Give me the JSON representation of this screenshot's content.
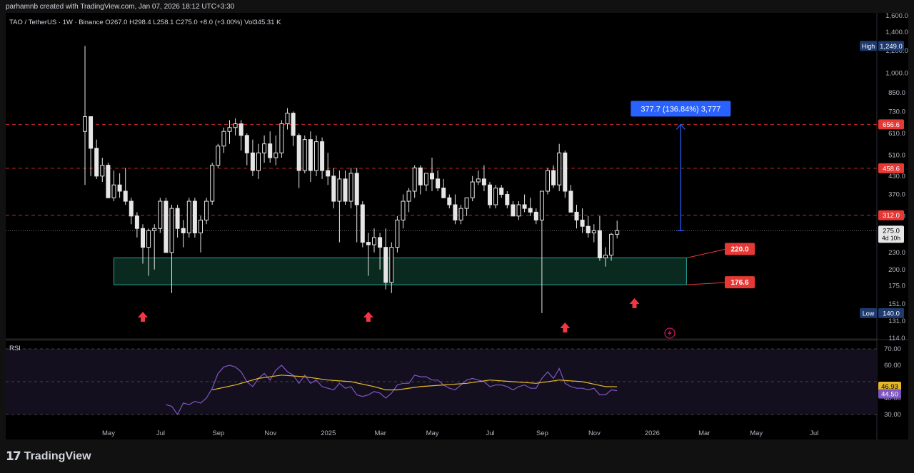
{
  "header": {
    "caption": "parhamnb created with TradingView.com, Jan 07, 2026 18:12 UTC+3:30",
    "symbol_line": "TAO / TetherUS · 1W · Binance  O267.0  H298.4  L258.1  C275.0  +8.0 (+3.00%)  Vol345.31 K"
  },
  "footer": {
    "brand": "TradingView",
    "logo_icon": "tradingview-logo-icon"
  },
  "colors": {
    "bg": "#000000",
    "frame": "#111111",
    "candle": "#e6e6e6",
    "level_line": "#c62828",
    "level_badge": "#e53935",
    "zone_border": "#26a69a",
    "zone_fill": "#0b2a1f",
    "measure": "#2962ff",
    "arrow": "#f23645",
    "rsi_line": "#7e57c2",
    "rsi_ma": "#e5b829",
    "rsi_band": "#130f1f",
    "high_low_badge": "#1e3a6e"
  },
  "chart_data": [
    {
      "type": "candlestick",
      "title": "TAO / TetherUS · 1W · Binance",
      "ohlc_last": {
        "open": 267.0,
        "high": 298.4,
        "low": 258.1,
        "close": 275.0,
        "change": 8.0,
        "change_pct": 3.0,
        "volume": "345.31 K"
      },
      "y_scale": "log",
      "ylim": [
        114,
        1600
      ],
      "y_ticks": [
        "1,600.0",
        "1,400.0",
        "1,200.0",
        "1,000.0",
        "850.0",
        "730.0",
        "610.0",
        "510.0",
        "430.0",
        "370.0",
        "310.0",
        "275.0",
        "230.0",
        "200.0",
        "175.0",
        "151.0",
        "131.0",
        "114.0"
      ],
      "y_tick_values": [
        1600,
        1400,
        1200,
        1000,
        850,
        730,
        610,
        510,
        430,
        370,
        310,
        275,
        230,
        200,
        175,
        151,
        131,
        114
      ],
      "x_labels": [
        "May",
        "Jul",
        "Sep",
        "Nov",
        "2025",
        "Mar",
        "May",
        "Jul",
        "Sep",
        "Nov",
        "2026",
        "Mar",
        "May",
        "Jul"
      ],
      "x_label_weeks": [
        0,
        9,
        19,
        28,
        38,
        47,
        56,
        66,
        75,
        84,
        94,
        103,
        112,
        122
      ],
      "first_week": "2024-04-29",
      "candles": [
        [
          0,
          620,
          1249,
          400,
          700
        ],
        [
          1,
          700,
          700,
          430,
          540
        ],
        [
          2,
          540,
          580,
          420,
          430
        ],
        [
          3,
          430,
          500,
          410,
          470
        ],
        [
          4,
          470,
          480,
          360,
          360
        ],
        [
          5,
          360,
          450,
          350,
          400
        ],
        [
          6,
          400,
          440,
          360,
          380
        ],
        [
          7,
          380,
          460,
          340,
          350
        ],
        [
          8,
          350,
          360,
          290,
          310
        ],
        [
          9,
          310,
          320,
          260,
          280
        ],
        [
          10,
          280,
          290,
          210,
          240
        ],
        [
          11,
          240,
          280,
          190,
          275
        ],
        [
          12,
          275,
          290,
          200,
          280
        ],
        [
          13,
          280,
          360,
          270,
          350
        ],
        [
          14,
          350,
          360,
          230,
          230
        ],
        [
          15,
          230,
          340,
          165,
          330
        ],
        [
          16,
          330,
          340,
          260,
          280
        ],
        [
          17,
          280,
          300,
          240,
          270
        ],
        [
          18,
          270,
          360,
          260,
          350
        ],
        [
          19,
          350,
          360,
          260,
          270
        ],
        [
          20,
          270,
          310,
          230,
          300
        ],
        [
          21,
          300,
          360,
          290,
          350
        ],
        [
          22,
          350,
          480,
          340,
          470
        ],
        [
          23,
          470,
          560,
          460,
          550
        ],
        [
          24,
          550,
          640,
          520,
          620
        ],
        [
          25,
          620,
          680,
          560,
          640
        ],
        [
          26,
          640,
          690,
          600,
          660
        ],
        [
          27,
          660,
          680,
          530,
          600
        ],
        [
          28,
          600,
          610,
          470,
          520
        ],
        [
          29,
          520,
          580,
          430,
          450
        ],
        [
          30,
          450,
          560,
          420,
          520
        ],
        [
          31,
          520,
          600,
          480,
          560
        ],
        [
          32,
          560,
          620,
          480,
          500
        ],
        [
          33,
          500,
          600,
          470,
          520
        ],
        [
          34,
          520,
          680,
          500,
          660
        ],
        [
          35,
          660,
          750,
          630,
          720
        ],
        [
          36,
          720,
          730,
          550,
          600
        ],
        [
          37,
          600,
          610,
          390,
          450
        ],
        [
          38,
          450,
          600,
          440,
          580
        ],
        [
          39,
          580,
          620,
          410,
          450
        ],
        [
          40,
          450,
          600,
          430,
          570
        ],
        [
          41,
          570,
          590,
          420,
          450
        ],
        [
          42,
          450,
          520,
          400,
          430
        ],
        [
          43,
          430,
          460,
          330,
          350
        ],
        [
          44,
          350,
          450,
          250,
          420
        ],
        [
          45,
          420,
          450,
          340,
          350
        ],
        [
          46,
          350,
          460,
          330,
          440
        ],
        [
          47,
          440,
          460,
          250,
          340
        ],
        [
          48,
          340,
          350,
          240,
          250
        ],
        [
          49,
          250,
          270,
          190,
          245
        ],
        [
          50,
          245,
          280,
          230,
          260
        ],
        [
          51,
          260,
          270,
          200,
          240
        ],
        [
          52,
          240,
          280,
          170,
          180
        ],
        [
          53,
          180,
          250,
          165,
          240
        ],
        [
          54,
          240,
          310,
          230,
          300
        ],
        [
          55,
          300,
          370,
          280,
          350
        ],
        [
          56,
          350,
          390,
          320,
          380
        ],
        [
          57,
          380,
          470,
          360,
          460
        ],
        [
          58,
          460,
          470,
          370,
          400
        ],
        [
          59,
          400,
          440,
          380,
          440
        ],
        [
          60,
          440,
          500,
          380,
          420
        ],
        [
          61,
          420,
          450,
          380,
          390
        ],
        [
          62,
          390,
          420,
          360,
          360
        ],
        [
          63,
          360,
          370,
          330,
          340
        ],
        [
          64,
          340,
          370,
          290,
          300
        ],
        [
          65,
          300,
          340,
          290,
          330
        ],
        [
          66,
          330,
          360,
          310,
          360
        ],
        [
          67,
          360,
          430,
          350,
          410
        ],
        [
          68,
          410,
          450,
          400,
          420
        ],
        [
          69,
          420,
          470,
          380,
          400
        ],
        [
          70,
          400,
          410,
          330,
          340
        ],
        [
          71,
          340,
          400,
          330,
          390
        ],
        [
          72,
          390,
          400,
          360,
          370
        ],
        [
          73,
          370,
          380,
          330,
          340
        ],
        [
          74,
          340,
          350,
          310,
          310
        ],
        [
          75,
          310,
          350,
          300,
          340
        ],
        [
          76,
          340,
          370,
          320,
          330
        ],
        [
          77,
          330,
          360,
          310,
          320
        ],
        [
          78,
          320,
          330,
          290,
          300
        ],
        [
          79,
          300,
          380,
          140,
          380
        ],
        [
          80,
          380,
          460,
          370,
          450
        ],
        [
          81,
          450,
          470,
          390,
          400
        ],
        [
          82,
          400,
          560,
          380,
          520
        ],
        [
          83,
          520,
          530,
          360,
          380
        ],
        [
          84,
          380,
          400,
          320,
          320
        ],
        [
          85,
          320,
          340,
          280,
          300
        ],
        [
          86,
          300,
          330,
          270,
          285
        ],
        [
          87,
          285,
          310,
          260,
          270
        ],
        [
          88,
          270,
          290,
          250,
          275
        ],
        [
          89,
          275,
          310,
          215,
          220
        ],
        [
          90,
          220,
          240,
          205,
          225
        ],
        [
          91,
          225,
          270,
          215,
          267
        ],
        [
          92,
          267,
          298.4,
          258.1,
          275
        ]
      ]
    },
    {
      "type": "line",
      "title": "RSI",
      "ylim": [
        22,
        76
      ],
      "y_ticks": [
        "70.00",
        "60.00",
        "40.00",
        "30.00"
      ],
      "y_tick_values": [
        70,
        60,
        40,
        30
      ],
      "band": [
        30,
        70
      ],
      "midline": 50,
      "series": [
        {
          "name": "RSI",
          "values": [
            [
              14,
              36
            ],
            [
              15,
              35
            ],
            [
              16,
              30
            ],
            [
              17,
              37
            ],
            [
              18,
              36
            ],
            [
              19,
              38
            ],
            [
              20,
              37
            ],
            [
              21,
              40
            ],
            [
              22,
              46
            ],
            [
              23,
              55
            ],
            [
              24,
              59
            ],
            [
              25,
              60
            ],
            [
              26,
              59
            ],
            [
              27,
              56
            ],
            [
              28,
              50
            ],
            [
              29,
              47
            ],
            [
              30,
              52
            ],
            [
              31,
              55
            ],
            [
              32,
              51
            ],
            [
              33,
              57
            ],
            [
              34,
              60
            ],
            [
              35,
              56
            ],
            [
              36,
              54
            ],
            [
              37,
              49
            ],
            [
              38,
              54
            ],
            [
              39,
              49
            ],
            [
              40,
              51
            ],
            [
              41,
              47
            ],
            [
              42,
              46
            ],
            [
              43,
              45
            ],
            [
              44,
              49
            ],
            [
              45,
              46
            ],
            [
              46,
              47
            ],
            [
              47,
              42
            ],
            [
              48,
              41
            ],
            [
              49,
              42
            ],
            [
              50,
              44
            ],
            [
              51,
              43
            ],
            [
              52,
              40
            ],
            [
              53,
              43
            ],
            [
              54,
              48
            ],
            [
              55,
              49
            ],
            [
              56,
              49
            ],
            [
              57,
              54
            ],
            [
              58,
              53
            ],
            [
              59,
              53
            ],
            [
              60,
              51
            ],
            [
              61,
              51
            ],
            [
              62,
              48
            ],
            [
              63,
              46
            ],
            [
              64,
              45
            ],
            [
              65,
              48
            ],
            [
              66,
              51
            ],
            [
              67,
              52
            ],
            [
              68,
              51
            ],
            [
              69,
              50
            ],
            [
              70,
              47
            ],
            [
              71,
              48
            ],
            [
              72,
              48
            ],
            [
              73,
              47
            ],
            [
              74,
              45
            ],
            [
              75,
              47
            ],
            [
              76,
              48
            ],
            [
              77,
              46
            ],
            [
              78,
              46
            ],
            [
              79,
              52
            ],
            [
              80,
              56
            ],
            [
              81,
              52
            ],
            [
              82,
              58
            ],
            [
              83,
              49
            ],
            [
              84,
              47
            ],
            [
              85,
              46
            ],
            [
              86,
              46
            ],
            [
              87,
              45
            ],
            [
              88,
              46
            ],
            [
              89,
              42
            ],
            [
              90,
              42
            ],
            [
              91,
              45
            ],
            [
              92,
              44.5
            ]
          ]
        },
        {
          "name": "RSI-based MA",
          "values": [
            [
              22,
              45
            ],
            [
              26,
              48
            ],
            [
              30,
              52
            ],
            [
              34,
              54
            ],
            [
              38,
              53
            ],
            [
              42,
              51
            ],
            [
              46,
              50
            ],
            [
              50,
              47
            ],
            [
              52,
              45
            ],
            [
              54,
              45
            ],
            [
              58,
              47
            ],
            [
              62,
              48
            ],
            [
              66,
              49
            ],
            [
              70,
              51
            ],
            [
              74,
              50
            ],
            [
              78,
              49
            ],
            [
              82,
              51
            ],
            [
              86,
              50
            ],
            [
              90,
              47
            ],
            [
              92,
              46.93
            ]
          ]
        }
      ],
      "values_now": {
        "ma": "46.93",
        "rsi": "44.50"
      }
    }
  ],
  "annotations": {
    "price_now": "275.0",
    "countdown": "4d 10h",
    "high": {
      "label": "High",
      "value": "1,249.0"
    },
    "low": {
      "label": "Low",
      "value": "140.0"
    },
    "levels": [
      {
        "value": 656.6,
        "text": "656.6"
      },
      {
        "value": 458.6,
        "text": "458.6"
      },
      {
        "value": 312.0,
        "text": "312.0"
      }
    ],
    "zone": {
      "top": 220.0,
      "bottom": 176.6,
      "start_week": 5,
      "end_week": 104,
      "top_text": "220.0",
      "bottom_text": "176.6"
    },
    "measure": {
      "from": 275.0,
      "to": 656.6,
      "week": 103,
      "label": "377.7 (136.84%) 3,777"
    },
    "arrows": [
      10,
      49,
      83,
      95
    ],
    "lightning_icon": "lightning-icon"
  }
}
